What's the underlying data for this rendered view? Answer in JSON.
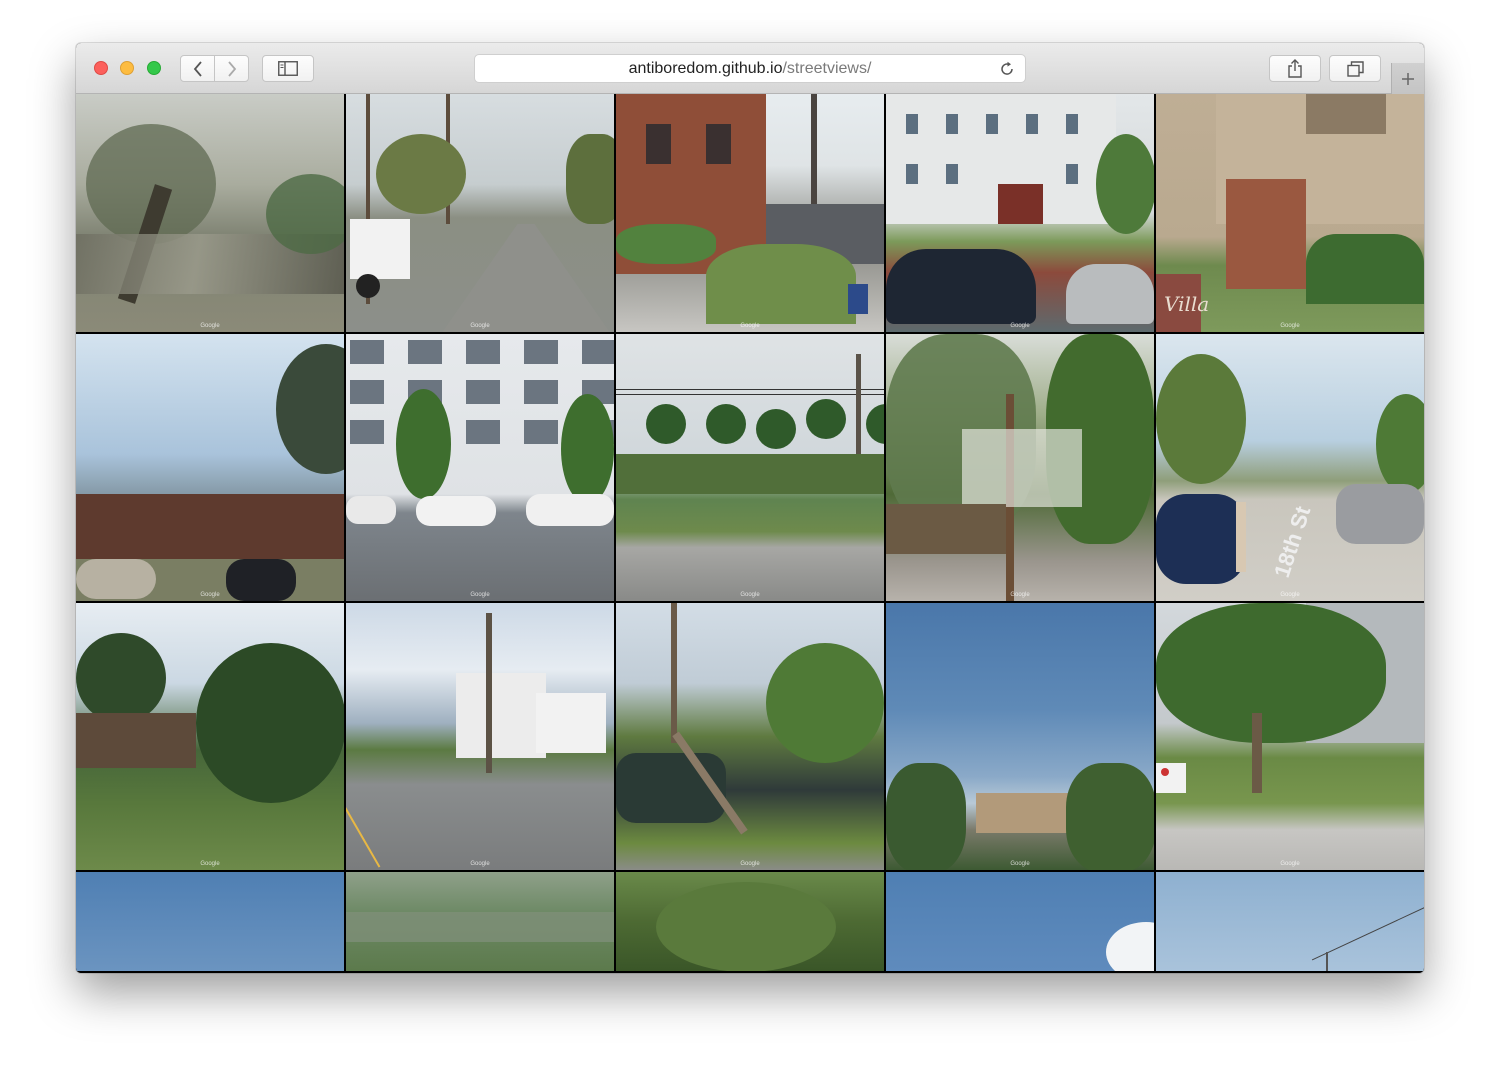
{
  "browser": {
    "url_domain": "antiboredom.github.io",
    "url_path": "/streetviews/",
    "icons": {
      "back": "chevron-left-icon",
      "forward": "chevron-right-icon",
      "sidebar": "sidebar-icon",
      "reload": "reload-icon",
      "share": "share-icon",
      "tabs": "tabs-overview-icon",
      "new_tab": "plus-icon"
    }
  },
  "gallery": {
    "watermark": "Google",
    "tiles": [
      {
        "scene": "blurred-tree-motion"
      },
      {
        "scene": "street-with-truck"
      },
      {
        "scene": "brick-building-parking"
      },
      {
        "scene": "white-building-cars"
      },
      {
        "scene": "beige-house-villa"
      },
      {
        "scene": "townhouses-sky"
      },
      {
        "scene": "white-apartment-building"
      },
      {
        "scene": "palm-trees-street"
      },
      {
        "scene": "trees-utility-pole"
      },
      {
        "scene": "beach-street-18th-st"
      },
      {
        "scene": "house-in-trees"
      },
      {
        "scene": "white-houses-road"
      },
      {
        "scene": "parking-lot-pole"
      },
      {
        "scene": "blue-sky-trees"
      },
      {
        "scene": "office-tree-sidewalk"
      },
      {
        "scene": "sky-partial"
      },
      {
        "scene": "blurred-green"
      },
      {
        "scene": "tree-canopy"
      },
      {
        "scene": "sky-cloud"
      },
      {
        "scene": "sky-power-lines"
      }
    ],
    "text_on_images": {
      "villa_sign": "Villa",
      "street_marking": "18th St"
    }
  },
  "colors": {
    "toolbar_top": "#ebebeb",
    "toolbar_bottom": "#d6d6d6",
    "close": "#fc605c",
    "minimize": "#fdbc40",
    "zoom": "#34c84a"
  }
}
